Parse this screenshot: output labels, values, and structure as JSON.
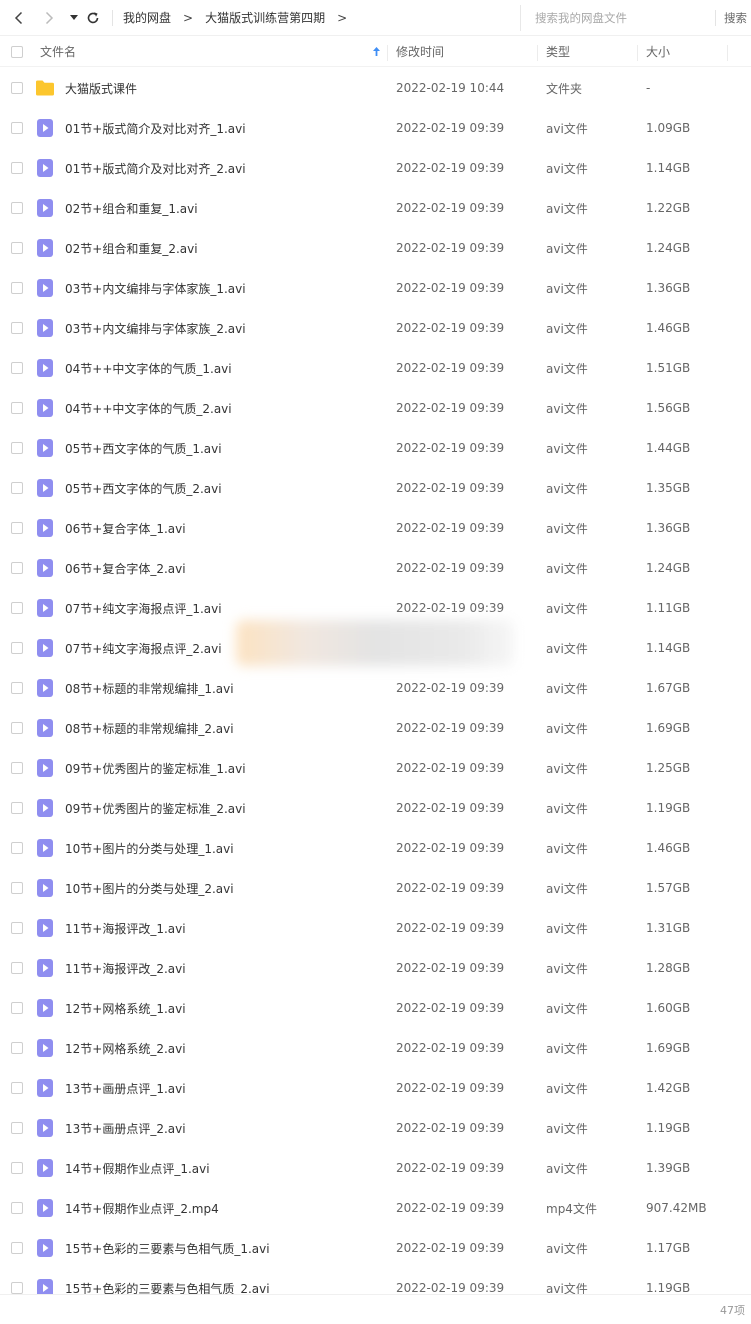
{
  "topbar": {
    "breadcrumb": [
      "我的网盘",
      "大猫版式训练营第四期"
    ],
    "crumb_separator": ">",
    "search_placeholder": "搜索我的网盘文件",
    "search_button": "搜索"
  },
  "header": {
    "name": "文件名",
    "time": "修改时间",
    "type": "类型",
    "size": "大小"
  },
  "colors": {
    "folder": "#fcc62d",
    "video": "#8f8ef0",
    "sort_arrow": "#3f8ef5"
  },
  "files": [
    {
      "name": "大猫版式课件",
      "time": "2022-02-19 10:44",
      "type": "文件夹",
      "size": "-",
      "icon": "folder-icon"
    },
    {
      "name": "01节+版式简介及对比对齐_1.avi",
      "time": "2022-02-19 09:39",
      "type": "avi文件",
      "size": "1.09GB",
      "icon": "video-file-icon"
    },
    {
      "name": "01节+版式简介及对比对齐_2.avi",
      "time": "2022-02-19 09:39",
      "type": "avi文件",
      "size": "1.14GB",
      "icon": "video-file-icon"
    },
    {
      "name": "02节+组合和重复_1.avi",
      "time": "2022-02-19 09:39",
      "type": "avi文件",
      "size": "1.22GB",
      "icon": "video-file-icon"
    },
    {
      "name": "02节+组合和重复_2.avi",
      "time": "2022-02-19 09:39",
      "type": "avi文件",
      "size": "1.24GB",
      "icon": "video-file-icon"
    },
    {
      "name": "03节+内文编排与字体家族_1.avi",
      "time": "2022-02-19 09:39",
      "type": "avi文件",
      "size": "1.36GB",
      "icon": "video-file-icon"
    },
    {
      "name": "03节+内文编排与字体家族_2.avi",
      "time": "2022-02-19 09:39",
      "type": "avi文件",
      "size": "1.46GB",
      "icon": "video-file-icon"
    },
    {
      "name": "04节++中文字体的气质_1.avi",
      "time": "2022-02-19 09:39",
      "type": "avi文件",
      "size": "1.51GB",
      "icon": "video-file-icon"
    },
    {
      "name": "04节++中文字体的气质_2.avi",
      "time": "2022-02-19 09:39",
      "type": "avi文件",
      "size": "1.56GB",
      "icon": "video-file-icon"
    },
    {
      "name": "05节+西文字体的气质_1.avi",
      "time": "2022-02-19 09:39",
      "type": "avi文件",
      "size": "1.44GB",
      "icon": "video-file-icon"
    },
    {
      "name": "05节+西文字体的气质_2.avi",
      "time": "2022-02-19 09:39",
      "type": "avi文件",
      "size": "1.35GB",
      "icon": "video-file-icon"
    },
    {
      "name": "06节+复合字体_1.avi",
      "time": "2022-02-19 09:39",
      "type": "avi文件",
      "size": "1.36GB",
      "icon": "video-file-icon"
    },
    {
      "name": "06节+复合字体_2.avi",
      "time": "2022-02-19 09:39",
      "type": "avi文件",
      "size": "1.24GB",
      "icon": "video-file-icon"
    },
    {
      "name": "07节+纯文字海报点评_1.avi",
      "time": "2022-02-19 09:39",
      "type": "avi文件",
      "size": "1.11GB",
      "icon": "video-file-icon"
    },
    {
      "name": "07节+纯文字海报点评_2.avi",
      "time": "",
      "type": "avi文件",
      "size": "1.14GB",
      "icon": "video-file-icon"
    },
    {
      "name": "08节+标题的非常规编排_1.avi",
      "time": "2022-02-19 09:39",
      "type": "avi文件",
      "size": "1.67GB",
      "icon": "video-file-icon"
    },
    {
      "name": "08节+标题的非常规编排_2.avi",
      "time": "2022-02-19 09:39",
      "type": "avi文件",
      "size": "1.69GB",
      "icon": "video-file-icon"
    },
    {
      "name": "09节+优秀图片的鉴定标准_1.avi",
      "time": "2022-02-19 09:39",
      "type": "avi文件",
      "size": "1.25GB",
      "icon": "video-file-icon"
    },
    {
      "name": "09节+优秀图片的鉴定标准_2.avi",
      "time": "2022-02-19 09:39",
      "type": "avi文件",
      "size": "1.19GB",
      "icon": "video-file-icon"
    },
    {
      "name": "10节+图片的分类与处理_1.avi",
      "time": "2022-02-19 09:39",
      "type": "avi文件",
      "size": "1.46GB",
      "icon": "video-file-icon"
    },
    {
      "name": "10节+图片的分类与处理_2.avi",
      "time": "2022-02-19 09:39",
      "type": "avi文件",
      "size": "1.57GB",
      "icon": "video-file-icon"
    },
    {
      "name": "11节+海报评改_1.avi",
      "time": "2022-02-19 09:39",
      "type": "avi文件",
      "size": "1.31GB",
      "icon": "video-file-icon"
    },
    {
      "name": "11节+海报评改_2.avi",
      "time": "2022-02-19 09:39",
      "type": "avi文件",
      "size": "1.28GB",
      "icon": "video-file-icon"
    },
    {
      "name": "12节+网格系统_1.avi",
      "time": "2022-02-19 09:39",
      "type": "avi文件",
      "size": "1.60GB",
      "icon": "video-file-icon"
    },
    {
      "name": "12节+网格系统_2.avi",
      "time": "2022-02-19 09:39",
      "type": "avi文件",
      "size": "1.69GB",
      "icon": "video-file-icon"
    },
    {
      "name": "13节+画册点评_1.avi",
      "time": "2022-02-19 09:39",
      "type": "avi文件",
      "size": "1.42GB",
      "icon": "video-file-icon"
    },
    {
      "name": "13节+画册点评_2.avi",
      "time": "2022-02-19 09:39",
      "type": "avi文件",
      "size": "1.19GB",
      "icon": "video-file-icon"
    },
    {
      "name": "14节+假期作业点评_1.avi",
      "time": "2022-02-19 09:39",
      "type": "avi文件",
      "size": "1.39GB",
      "icon": "video-file-icon"
    },
    {
      "name": "14节+假期作业点评_2.mp4",
      "time": "2022-02-19 09:39",
      "type": "mp4文件",
      "size": "907.42MB",
      "icon": "video-file-icon"
    },
    {
      "name": "15节+色彩的三要素与色相气质_1.avi",
      "time": "2022-02-19 09:39",
      "type": "avi文件",
      "size": "1.17GB",
      "icon": "video-file-icon"
    },
    {
      "name": "15节+色彩的三要素与色相气质_2.avi",
      "time": "2022-02-19 09:39",
      "type": "avi文件",
      "size": "1.19GB",
      "icon": "video-file-icon"
    }
  ],
  "footer": {
    "item_count": "47项"
  }
}
